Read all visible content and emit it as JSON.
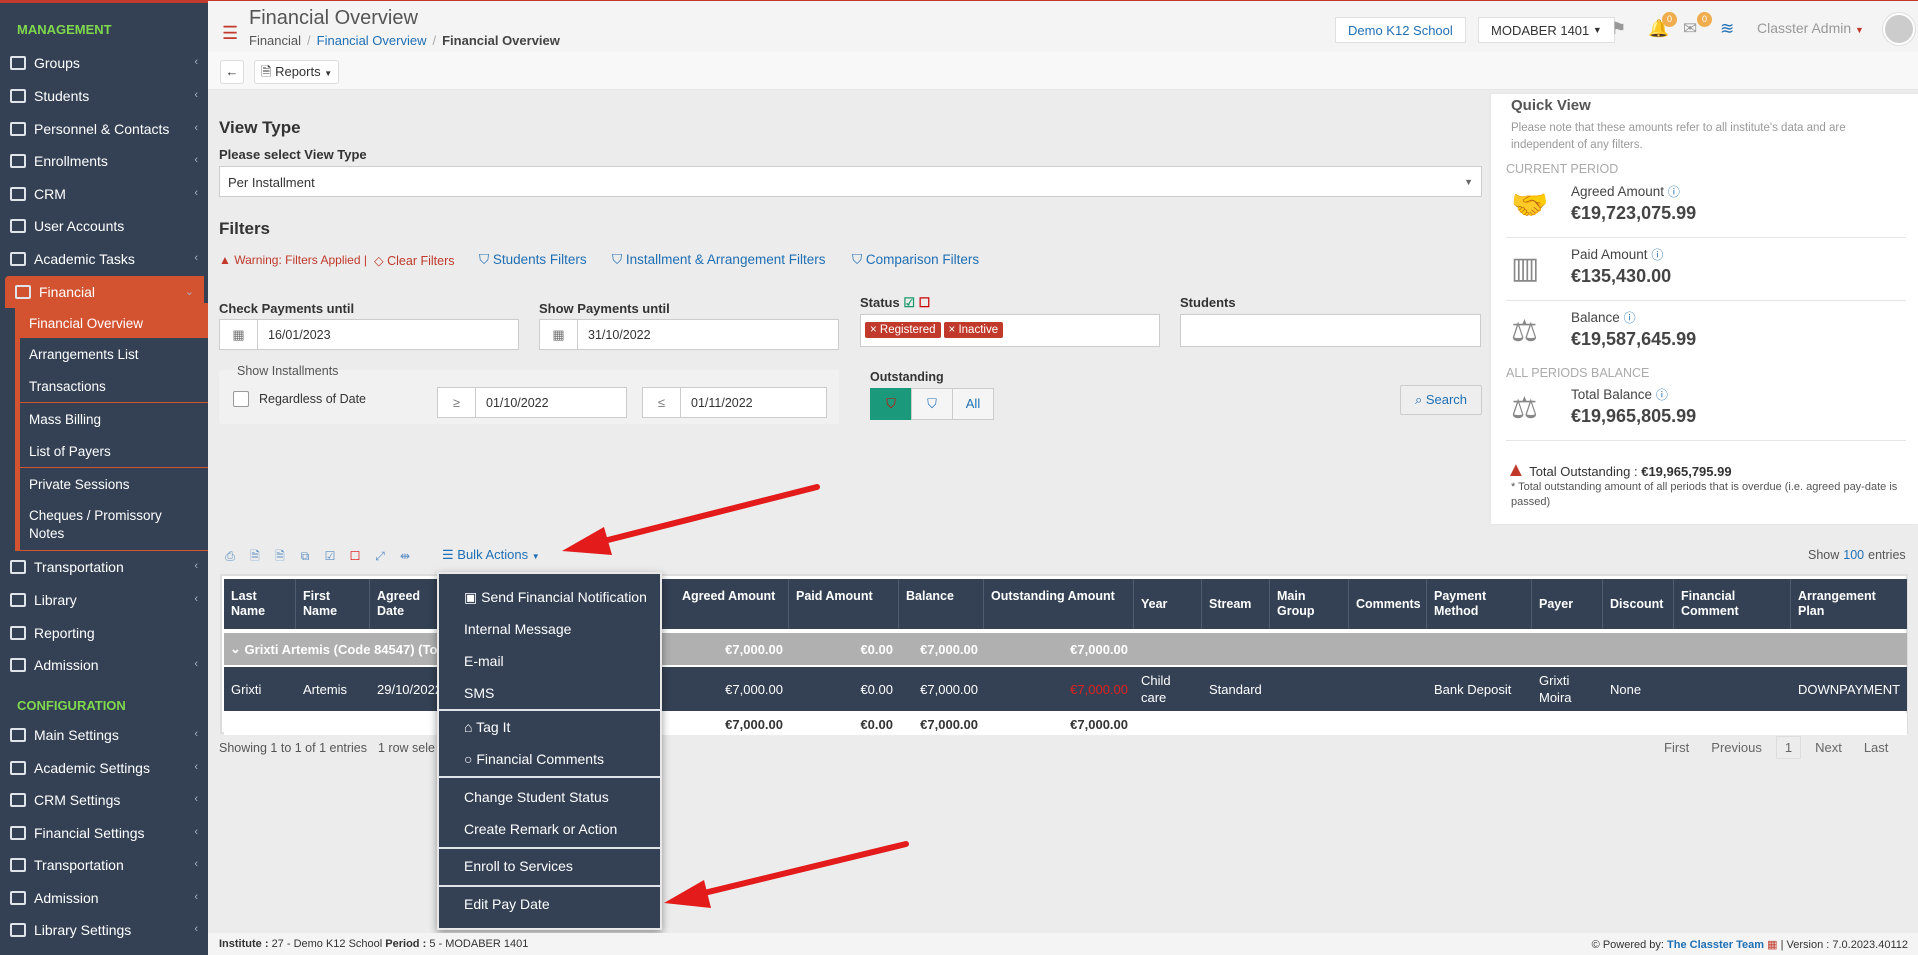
{
  "sidebar": {
    "management_title": "MANAGEMENT",
    "items": [
      {
        "label": "Groups"
      },
      {
        "label": "Students"
      },
      {
        "label": "Personnel & Contacts"
      },
      {
        "label": "Enrollments"
      },
      {
        "label": "CRM"
      },
      {
        "label": "User Accounts"
      },
      {
        "label": "Academic Tasks"
      },
      {
        "label": "Financial"
      }
    ],
    "financial_sub": [
      {
        "label": "Financial Overview"
      },
      {
        "label": "Arrangements List"
      },
      {
        "label": "Transactions"
      },
      {
        "label": "Mass Billing"
      },
      {
        "label": "List of Payers"
      },
      {
        "label": "Private Sessions"
      },
      {
        "label": "Cheques / Promissory"
      },
      {
        "label": "Notes"
      }
    ],
    "items2": [
      {
        "label": "Transportation"
      },
      {
        "label": "Library"
      },
      {
        "label": "Reporting"
      },
      {
        "label": "Admission"
      }
    ],
    "config_title": "CONFIGURATION",
    "config_items": [
      {
        "label": "Main Settings"
      },
      {
        "label": "Academic Settings"
      },
      {
        "label": "CRM Settings"
      },
      {
        "label": "Financial Settings"
      },
      {
        "label": "Transportation"
      },
      {
        "label": "Admission"
      },
      {
        "label": "Library Settings"
      }
    ]
  },
  "header": {
    "title": "Financial Overview",
    "crumbs": [
      "Financial",
      "Financial Overview",
      "Financial Overview"
    ],
    "school": "Demo K12 School",
    "period": "MODABER 1401",
    "notif_count": "0",
    "mail_count": "0",
    "user": "Classter Admin"
  },
  "toolbar": {
    "reports": "Reports"
  },
  "viewtype": {
    "title": "View Type",
    "label": "Please select View Type",
    "value": "Per Installment"
  },
  "filters": {
    "title": "Filters",
    "warning": "Warning: Filters Applied",
    "clear": "Clear Filters",
    "links": [
      "Students Filters",
      "Installment & Arrangement Filters",
      "Comparison Filters"
    ],
    "check_label": "Check Payments until",
    "check_value": "16/01/2023",
    "show_label": "Show Payments until",
    "show_value": "31/10/2022",
    "status_label": "Status",
    "status_tags": [
      "Registered",
      "Inactive"
    ],
    "students_label": "Students",
    "show_inst_label": "Show Installments",
    "regardless": "Regardless of Date",
    "ge_value": "01/10/2022",
    "le_value": "01/11/2022",
    "outstanding_label": "Outstanding",
    "all_label": "All",
    "search": "Search"
  },
  "quickview": {
    "title": "Quick View",
    "note": "Please note that these amounts refer to all institute's data and are independent of any filters.",
    "current_period": "CURRENT PERIOD",
    "agreed_label": "Agreed Amount",
    "agreed_value": "€19,723,075.99",
    "paid_label": "Paid Amount",
    "paid_value": "€135,430.00",
    "balance_label": "Balance",
    "balance_value": "€19,587,645.99",
    "all_periods": "ALL PERIODS BALANCE",
    "total_label": "Total Balance",
    "total_value": "€19,965,805.99",
    "outstanding_label": "Total Outstanding :",
    "outstanding_value": "€19,965,795.99",
    "outstanding_note": "* Total outstanding amount of all periods that is overdue (i.e. agreed pay-date is passed)"
  },
  "table": {
    "bulk": "Bulk Actions",
    "show": "Show",
    "show_n": "100",
    "entries": "entries",
    "headers": [
      "Last Name",
      "First Name",
      "Agreed Date",
      "Agreed Amount",
      "Paid Amount",
      "Balance",
      "Outstanding Amount",
      "Year",
      "Stream",
      "Main Group",
      "Comments",
      "Payment Method",
      "Payer",
      "Discount",
      "Financial Comment",
      "Arrangement Plan"
    ],
    "group_label": "Grixti Artemis (Code 84547) (To",
    "group": {
      "agreed": "€7,000.00",
      "paid": "€0.00",
      "balance": "€7,000.00",
      "outstanding": "€7,000.00"
    },
    "row": {
      "last": "Grixti",
      "first": "Artemis",
      "date": "29/10/2022",
      "agreed": "€7,000.00",
      "paid": "€0.00",
      "balance": "€7,000.00",
      "outstanding": "€7,000.00",
      "year": "Child care",
      "stream": "Standard",
      "method": "Bank Deposit",
      "payer": "Grixti Moira",
      "discount": "None",
      "plan": "DOWNPAYMENT"
    },
    "total": {
      "agreed": "€7,000.00",
      "paid": "€0.00",
      "balance": "€7,000.00",
      "outstanding": "€7,000.00"
    },
    "showing": "Showing 1 to 1 of 1 entries",
    "rowsel": "1 row sele",
    "pager": [
      "First",
      "Previous",
      "1",
      "Next",
      "Last"
    ]
  },
  "bulk_menu": [
    "Send Financial Notification",
    "Internal Message",
    "E-mail",
    "SMS",
    "Tag It",
    "Financial Comments",
    "Change Student Status",
    "Create Remark or Action",
    "Enroll to Services",
    "Edit Pay Date"
  ],
  "footer": {
    "institute_label": "Institute :",
    "institute": "27 - Demo K12 School",
    "period_label": "Period :",
    "period": "5 - MODABER 1401",
    "powered": "Powered by:",
    "team": "The Classter Team",
    "version": "| Version : 7.0.2023.40112"
  },
  "colors": {
    "sidebar": "#344154",
    "accent": "#d35230",
    "link": "#1f6fb5",
    "arrow": "#e31b1b"
  }
}
